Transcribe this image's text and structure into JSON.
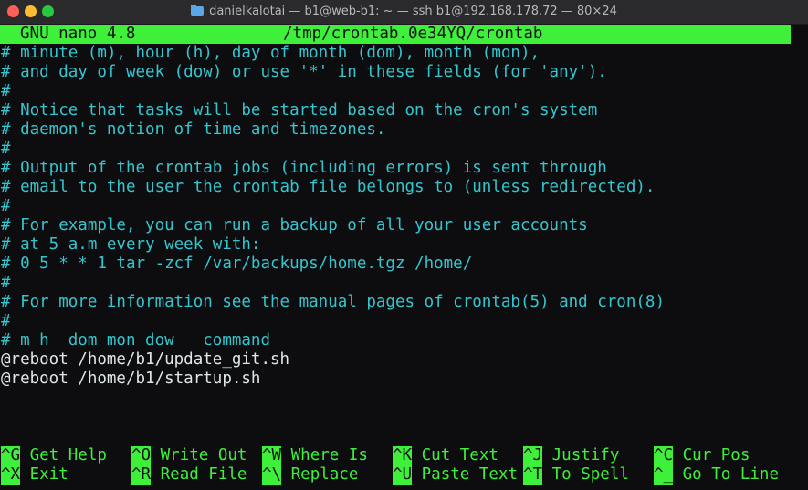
{
  "window": {
    "title": "danielkalotai — b1@web-b1: ~ — ssh b1@192.168.178.72 — 80×24"
  },
  "nano": {
    "version": "GNU nano 4.8",
    "filename": "/tmp/crontab.0e34YQ/crontab"
  },
  "lines": [
    "# minute (m), hour (h), day of month (dom), month (mon),",
    "# and day of week (dow) or use '*' in these fields (for 'any').",
    "#",
    "# Notice that tasks will be started based on the cron's system",
    "# daemon's notion of time and timezones.",
    "#",
    "# Output of the crontab jobs (including errors) is sent through",
    "# email to the user the crontab file belongs to (unless redirected).",
    "#",
    "# For example, you can run a backup of all your user accounts",
    "# at 5 a.m every week with:",
    "# 0 5 * * 1 tar -zcf /var/backups/home.tgz /home/",
    "#",
    "# For more information see the manual pages of crontab(5) and cron(8)",
    "#",
    "# m h  dom mon dow   command",
    "@reboot /home/b1/update_git.sh",
    "@reboot /home/b1/startup.sh"
  ],
  "shortcuts": [
    {
      "key": "^G",
      "label": "Get Help"
    },
    {
      "key": "^O",
      "label": "Write Out"
    },
    {
      "key": "^W",
      "label": "Where Is"
    },
    {
      "key": "^K",
      "label": "Cut Text"
    },
    {
      "key": "^J",
      "label": "Justify"
    },
    {
      "key": "^C",
      "label": "Cur Pos"
    },
    {
      "key": "^X",
      "label": "Exit"
    },
    {
      "key": "^R",
      "label": "Read File"
    },
    {
      "key": "^\\",
      "label": "Replace"
    },
    {
      "key": "^U",
      "label": "Paste Text"
    },
    {
      "key": "^T",
      "label": "To Spell"
    },
    {
      "key": "^_",
      "label": "Go To Line"
    }
  ],
  "colors": {
    "accent_green": "#3ef03a",
    "comment_cyan": "#34c6cf",
    "code_text": "#dfe6ea"
  }
}
